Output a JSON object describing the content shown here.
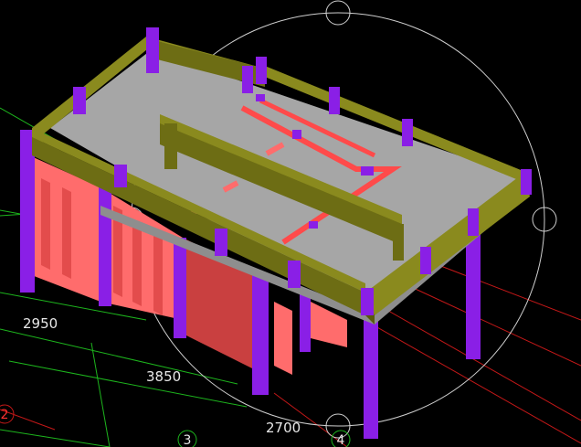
{
  "viewport": {
    "background": "#000000",
    "dimensions": {
      "d1": "2950",
      "d2": "3850",
      "d3": "2700"
    },
    "axis_labels": {
      "a2": "2",
      "a3": "3",
      "a4": "4"
    },
    "colors": {
      "slab_top": "#a6a6a6",
      "slab_edge": "#8e8e8e",
      "beam_top": "#8a8a1e",
      "beam_side": "#5a5a0c",
      "column": "#8a1fe6",
      "column_dark": "#5b0fa8",
      "wall": "#ff6c6c",
      "wall_dark": "#d54545",
      "grid_green": "#1db51d",
      "grid_red": "#c51818",
      "orbit": "#cfcfcf"
    }
  }
}
